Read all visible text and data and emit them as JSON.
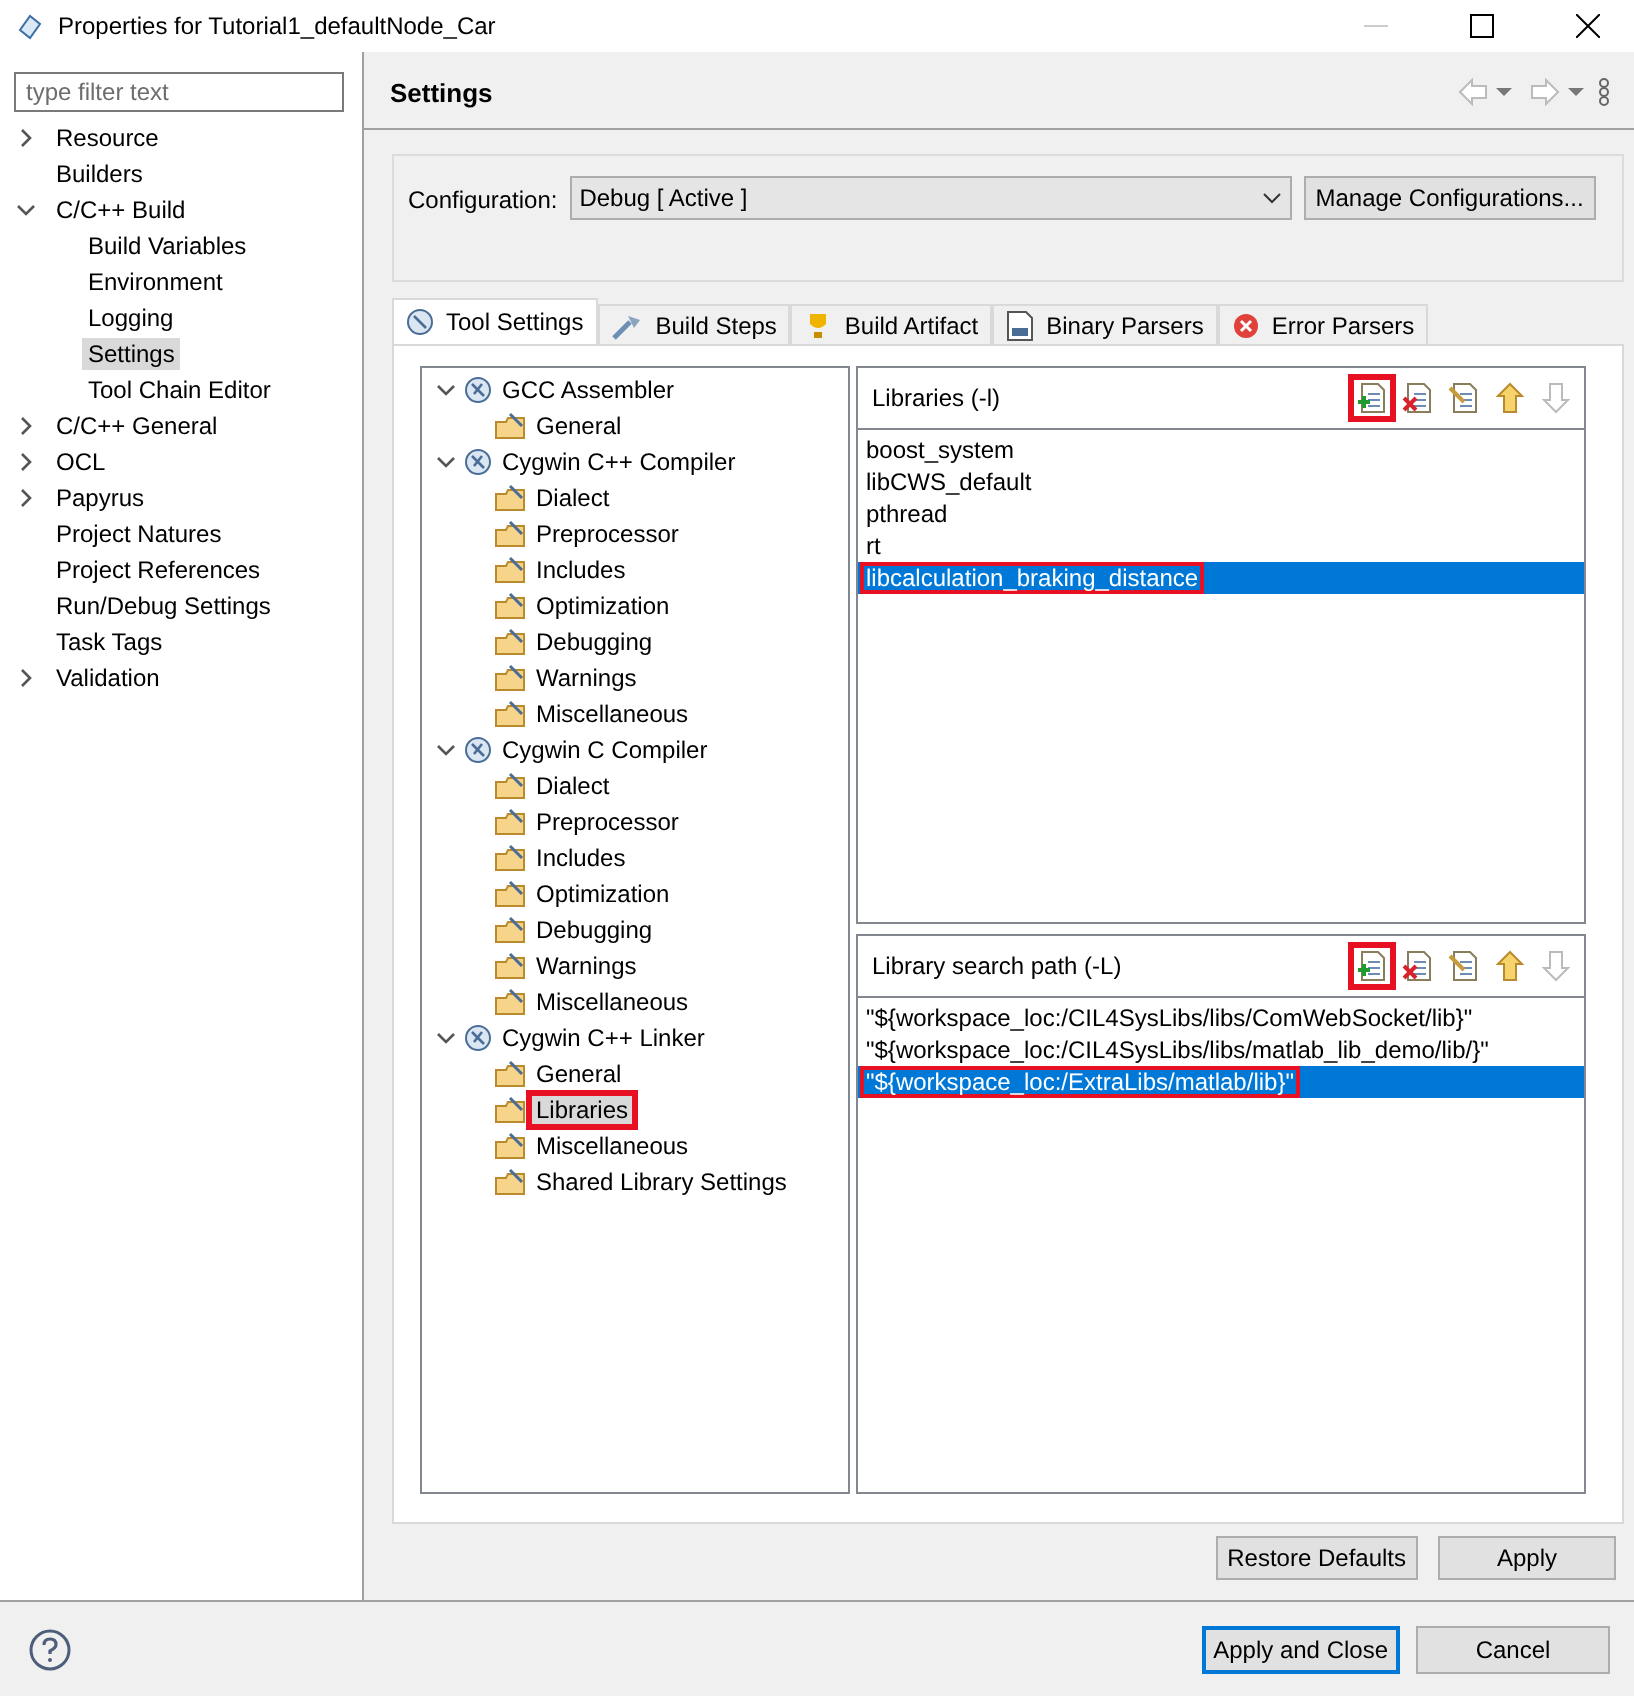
{
  "window": {
    "title": "Properties for Tutorial1_defaultNode_Car"
  },
  "filter": {
    "placeholder": "type filter text"
  },
  "nav_tree": [
    {
      "label": "Resource",
      "expanded": false,
      "selected": false
    },
    {
      "label": "Builders",
      "selected": false
    },
    {
      "label": "C/C++ Build",
      "expanded": true,
      "selected": false,
      "children": [
        {
          "label": "Build Variables",
          "selected": false
        },
        {
          "label": "Environment",
          "selected": false
        },
        {
          "label": "Logging",
          "selected": false
        },
        {
          "label": "Settings",
          "selected": true
        },
        {
          "label": "Tool Chain Editor",
          "selected": false
        }
      ]
    },
    {
      "label": "C/C++ General",
      "expanded": false,
      "selected": false
    },
    {
      "label": "OCL",
      "expanded": false,
      "selected": false
    },
    {
      "label": "Papyrus",
      "expanded": false,
      "selected": false
    },
    {
      "label": "Project Natures",
      "selected": false
    },
    {
      "label": "Project References",
      "selected": false
    },
    {
      "label": "Run/Debug Settings",
      "selected": false
    },
    {
      "label": "Task Tags",
      "selected": false
    },
    {
      "label": "Validation",
      "expanded": false,
      "selected": false
    }
  ],
  "page": {
    "title": "Settings"
  },
  "configuration": {
    "label": "Configuration:",
    "value": "Debug  [ Active ]",
    "button": "Manage Configurations..."
  },
  "tabs": [
    {
      "label": "Tool Settings",
      "selected": true
    },
    {
      "label": "Build Steps",
      "selected": false
    },
    {
      "label": "Build Artifact",
      "selected": false
    },
    {
      "label": "Binary Parsers",
      "selected": false
    },
    {
      "label": "Error Parsers",
      "selected": false
    }
  ],
  "tool_tree": [
    {
      "label": "GCC Assembler",
      "expanded": true,
      "children": [
        {
          "label": "General",
          "selected": false,
          "highlighted": false
        }
      ]
    },
    {
      "label": "Cygwin C++ Compiler",
      "expanded": true,
      "children": [
        {
          "label": "Dialect",
          "selected": false,
          "highlighted": false
        },
        {
          "label": "Preprocessor",
          "selected": false,
          "highlighted": false
        },
        {
          "label": "Includes",
          "selected": false,
          "highlighted": false
        },
        {
          "label": "Optimization",
          "selected": false,
          "highlighted": false
        },
        {
          "label": "Debugging",
          "selected": false,
          "highlighted": false
        },
        {
          "label": "Warnings",
          "selected": false,
          "highlighted": false
        },
        {
          "label": "Miscellaneous",
          "selected": false,
          "highlighted": false
        }
      ]
    },
    {
      "label": "Cygwin C Compiler",
      "expanded": true,
      "children": [
        {
          "label": "Dialect",
          "selected": false,
          "highlighted": false
        },
        {
          "label": "Preprocessor",
          "selected": false,
          "highlighted": false
        },
        {
          "label": "Includes",
          "selected": false,
          "highlighted": false
        },
        {
          "label": "Optimization",
          "selected": false,
          "highlighted": false
        },
        {
          "label": "Debugging",
          "selected": false,
          "highlighted": false
        },
        {
          "label": "Warnings",
          "selected": false,
          "highlighted": false
        },
        {
          "label": "Miscellaneous",
          "selected": false,
          "highlighted": false
        }
      ]
    },
    {
      "label": "Cygwin C++ Linker",
      "expanded": true,
      "children": [
        {
          "label": "General",
          "selected": false,
          "highlighted": false
        },
        {
          "label": "Libraries",
          "selected": true,
          "highlighted": true
        },
        {
          "label": "Miscellaneous",
          "selected": false,
          "highlighted": false
        },
        {
          "label": "Shared Library Settings",
          "selected": false,
          "highlighted": false
        }
      ]
    }
  ],
  "lists": [
    {
      "title": "Libraries (-l)",
      "add_highlighted": true,
      "items": [
        {
          "text": "boost_system",
          "selected": false,
          "highlighted": false
        },
        {
          "text": "libCWS_default",
          "selected": false,
          "highlighted": false
        },
        {
          "text": "pthread",
          "selected": false,
          "highlighted": false
        },
        {
          "text": "rt",
          "selected": false,
          "highlighted": false
        },
        {
          "text": "libcalculation_braking_distance",
          "selected": true,
          "highlighted": true
        }
      ]
    },
    {
      "title": "Library search path (-L)",
      "add_highlighted": true,
      "items": [
        {
          "text": "\"${workspace_loc:/CIL4SysLibs/libs/ComWebSocket/lib}\"",
          "selected": false,
          "highlighted": false
        },
        {
          "text": "\"${workspace_loc:/CIL4SysLibs/libs/matlab_lib_demo/lib/}\"",
          "selected": false,
          "highlighted": false
        },
        {
          "text": "\"${workspace_loc:/ExtraLibs/matlab/lib}\"",
          "selected": true,
          "highlighted": true
        }
      ]
    }
  ],
  "page_buttons": [
    "Restore Defaults",
    "Apply"
  ],
  "dialog_buttons": [
    {
      "label": "Apply and Close",
      "default": true
    },
    {
      "label": "Cancel",
      "default": false
    }
  ]
}
